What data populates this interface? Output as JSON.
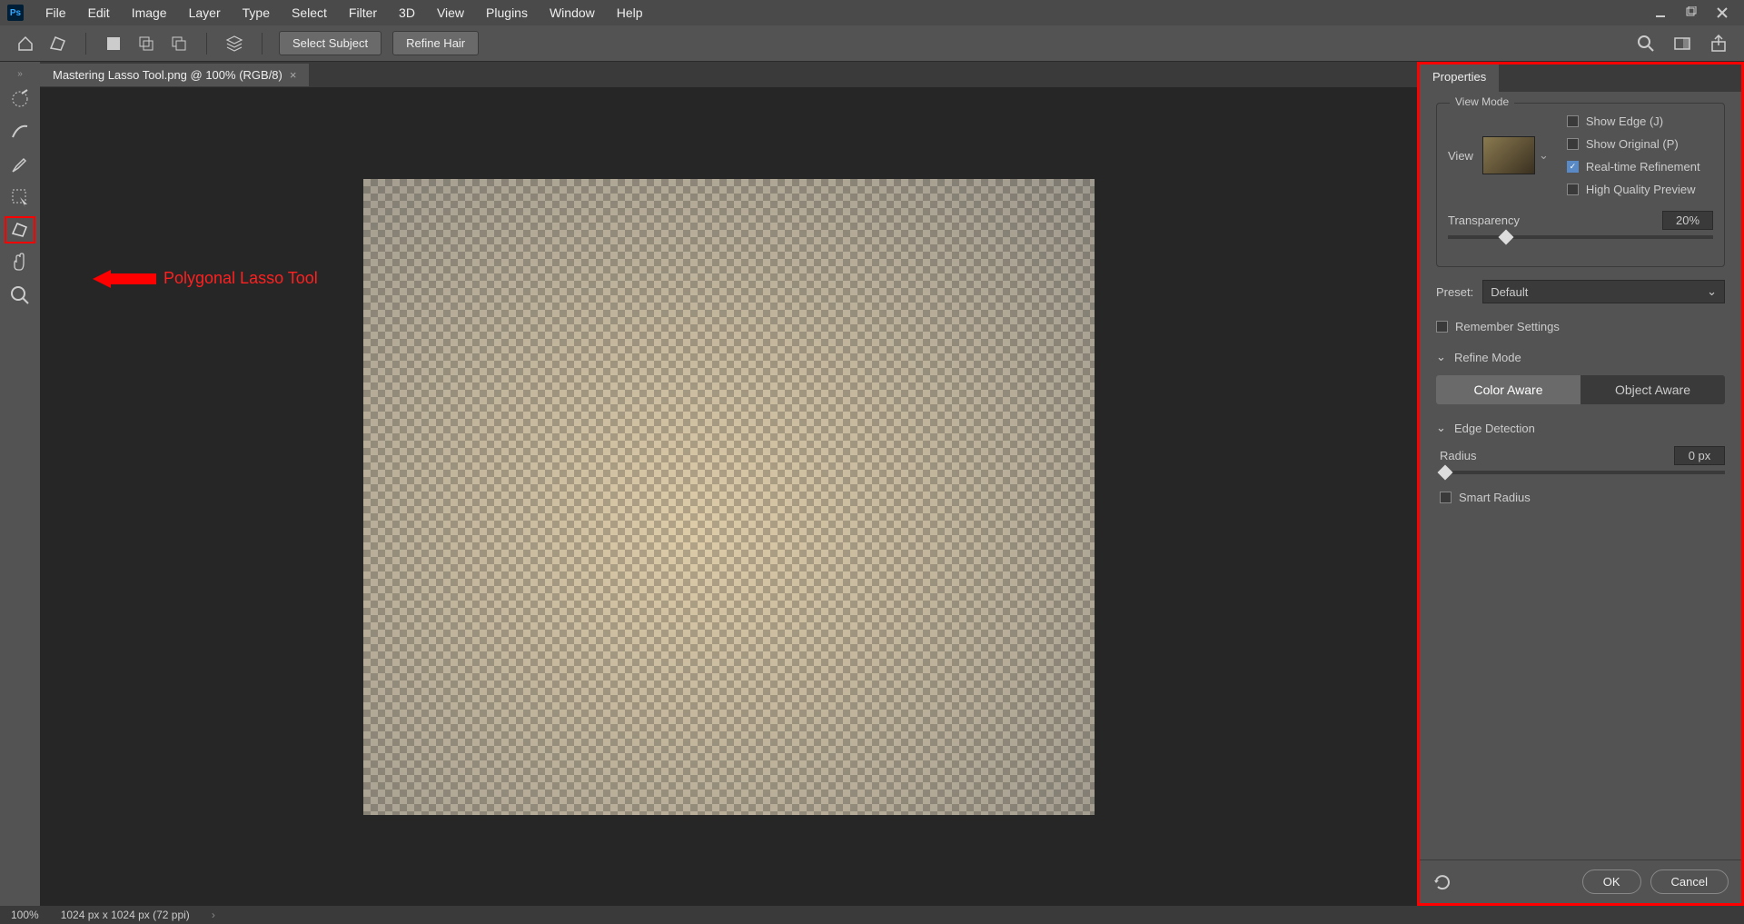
{
  "menubar": {
    "items": [
      "File",
      "Edit",
      "Image",
      "Layer",
      "Type",
      "Select",
      "Filter",
      "3D",
      "View",
      "Plugins",
      "Window",
      "Help"
    ]
  },
  "optionsbar": {
    "select_subject": "Select Subject",
    "refine_hair": "Refine Hair"
  },
  "document": {
    "tab_title": "Mastering Lasso Tool.png @ 100% (RGB/8)"
  },
  "annotation": {
    "label": "Polygonal Lasso Tool"
  },
  "statusbar": {
    "zoom": "100%",
    "dims": "1024 px x 1024 px (72 ppi)"
  },
  "properties": {
    "tab": "Properties",
    "view_mode_title": "View Mode",
    "view_label": "View",
    "checks": {
      "show_edge": "Show Edge (J)",
      "show_original": "Show Original (P)",
      "realtime": "Real-time Refinement",
      "hq_preview": "High Quality Preview"
    },
    "transparency": {
      "label": "Transparency",
      "value": "20%"
    },
    "preset": {
      "label": "Preset:",
      "value": "Default"
    },
    "remember": "Remember Settings",
    "refine_mode": {
      "title": "Refine Mode",
      "color_aware": "Color Aware",
      "object_aware": "Object Aware"
    },
    "edge_detection": {
      "title": "Edge Detection",
      "radius_label": "Radius",
      "radius_value": "0 px",
      "smart_radius": "Smart Radius"
    },
    "footer": {
      "ok": "OK",
      "cancel": "Cancel"
    }
  }
}
